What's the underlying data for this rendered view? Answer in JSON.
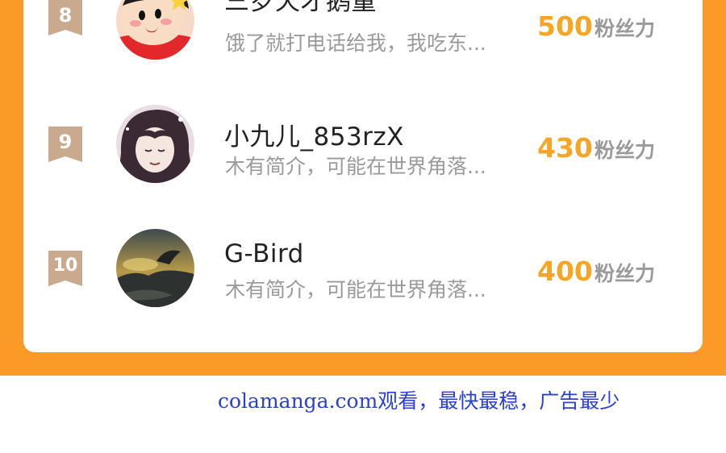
{
  "ranking": [
    {
      "rank": "8",
      "name": "三岁天才鹅童",
      "intro": "饿了就打电话给我，我吃东...",
      "fans_count": "500",
      "fans_unit": "粉丝力",
      "avatar_icon": "cartoon-boy-avatar-icon"
    },
    {
      "rank": "9",
      "name": "小九儿_853rzX",
      "intro": "木有简介，可能在世界角落...",
      "fans_count": "430",
      "fans_unit": "粉丝力",
      "avatar_icon": "anime-girl-avatar-icon"
    },
    {
      "rank": "10",
      "name": "G-Bird",
      "intro": "木有简介，可能在世界角落...",
      "fans_count": "400",
      "fans_unit": "粉丝力",
      "avatar_icon": "landscape-avatar-icon"
    }
  ],
  "footer": {
    "watermark": "colamanga.com观看，最快最稳，广告最少"
  },
  "colors": {
    "background_orange": "#fb9a26",
    "fans_count_orange": "#f7a524",
    "rank_badge": "#c9aa8f",
    "watermark_blue": "#2a3fd4"
  }
}
